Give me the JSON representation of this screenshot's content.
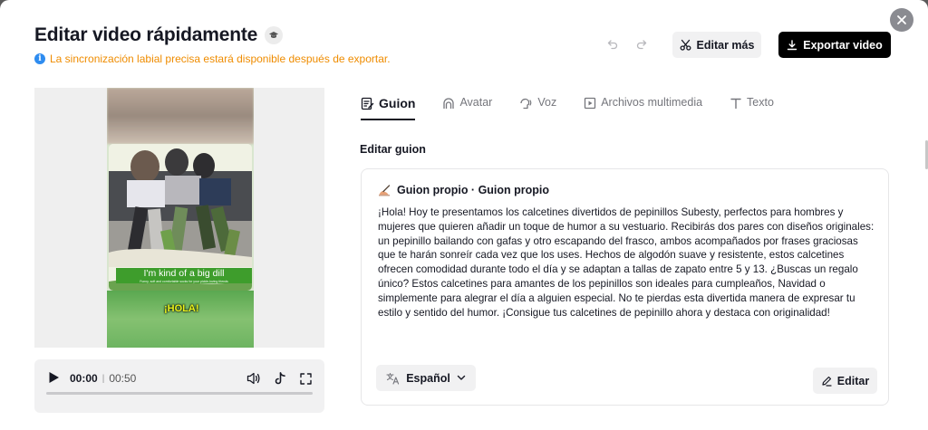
{
  "header": {
    "title": "Editar video rápidamente",
    "info": "La sincronización labial precisa estará disponible después de exportar.",
    "edit_more_label": "Editar más",
    "export_label": "Exportar video"
  },
  "preview": {
    "caption_hola": "¡HOLA!",
    "banner_text": "I'm kind of a big dill",
    "banner_subtext": "Funny, soft and comfortable socks for your pickle-loving friends"
  },
  "player": {
    "current_time": "00:00",
    "separator": "|",
    "duration": "00:50",
    "progress_fraction": 0
  },
  "tabs": [
    {
      "label": "Guion",
      "icon": "script-icon",
      "active": true
    },
    {
      "label": "Avatar",
      "icon": "avatar-icon",
      "active": false
    },
    {
      "label": "Voz",
      "icon": "voice-icon",
      "active": false
    },
    {
      "label": "Archivos multimedia",
      "icon": "media-icon",
      "active": false
    },
    {
      "label": "Texto",
      "icon": "text-icon",
      "active": false
    }
  ],
  "editor": {
    "section_label": "Editar guion",
    "script_source": "Guion propio · Guion propio",
    "script_text": "¡Hola! Hoy te presentamos los calcetines divertidos de pepinillos Subesty, perfectos para hombres y mujeres que quieren añadir un toque de humor a su vestuario. Recibirás dos pares con diseños originales: un pepinillo bailando con gafas y otro escapando del frasco, ambos acompañados por frases graciosas que te harán sonreír cada vez que los uses. Hechos de algodón suave y resistente, estos calcetines ofrecen comodidad durante todo el día y se adaptan a tallas de zapato entre 5 y 13. ¿Buscas un regalo único? Estos calcetines para amantes de los pepinillos son ideales para cumpleaños, Navidad o simplemente para alegrar el día a alguien especial. No te pierdas esta divertida manera de expresar tu estilo y sentido del humor. ¡Consigue tus calcetines de pepinillo ahora y destaca con originalidad!",
    "language": "Español",
    "edit_label": "Editar"
  },
  "colors": {
    "info_text": "#ef8c00",
    "info_icon": "#2e8cf0",
    "primary_button": "#000000",
    "banner_green": "#3e9d2c",
    "caption_yellow": "#e9f31c"
  }
}
